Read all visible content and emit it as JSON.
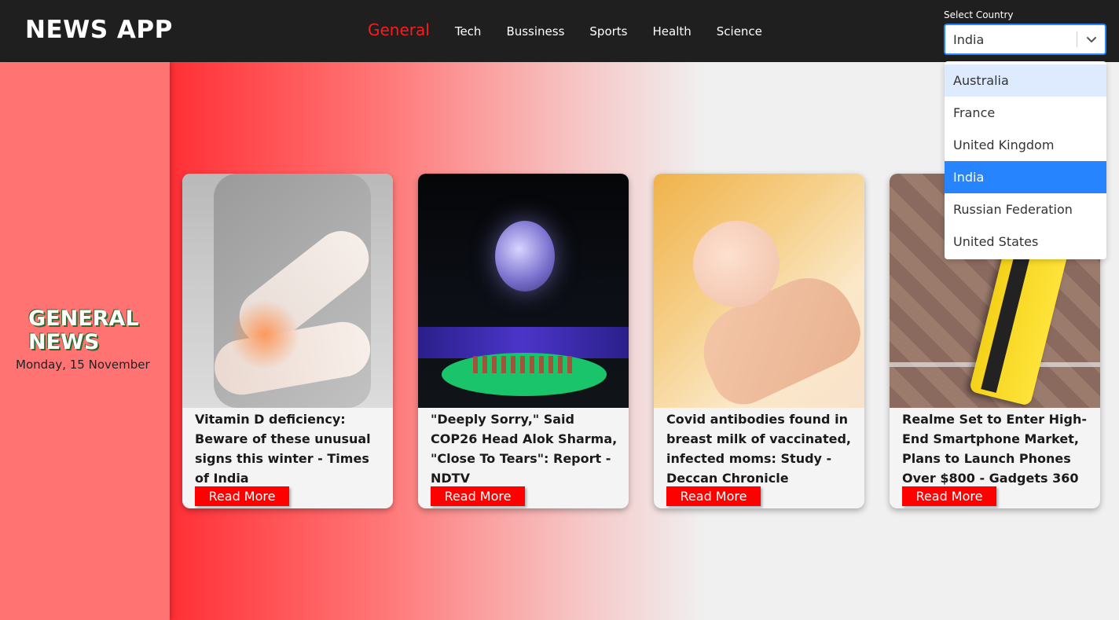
{
  "app": {
    "brand": "NEWS APP"
  },
  "nav": {
    "items": [
      {
        "label": "General",
        "active": true
      },
      {
        "label": "Tech",
        "active": false
      },
      {
        "label": "Bussiness",
        "active": false
      },
      {
        "label": "Sports",
        "active": false
      },
      {
        "label": "Health",
        "active": false
      },
      {
        "label": "Science",
        "active": false
      }
    ]
  },
  "country": {
    "label": "Select Country",
    "selected": "India",
    "options": [
      "Australia",
      "France",
      "United Kingdom",
      "India",
      "Russian Federation",
      "United States"
    ],
    "hovered": "Australia"
  },
  "sidebar": {
    "title_line1": "GENERAL",
    "title_line2": "NEWS",
    "date": "Monday, 15 November"
  },
  "articles": [
    {
      "title": "Vitamin D deficiency: Beware of these unusual signs this winter - Times of India",
      "button": "Read More",
      "image_icon": "elbow-pain-photo"
    },
    {
      "title": "\"Deeply Sorry,\" Said COP26 Head Alok Sharma, \"Close To Tears\": Report - NDTV",
      "button": "Read More",
      "image_icon": "globe-event-photo"
    },
    {
      "title": "Covid antibodies found in breast milk of vaccinated, infected moms: Study - Deccan Chronicle",
      "button": "Read More",
      "image_icon": "baby-hand-photo"
    },
    {
      "title": "Realme Set to Enter High-End Smartphone Market, Plans to Launch Phones Over $800 - Gadgets 360",
      "button": "Read More",
      "image_icon": "yellow-phone-photo"
    }
  ],
  "colors": {
    "accent_red": "#ff0000",
    "select_blue": "#2684ff",
    "header_bg": "#1f1f1f"
  }
}
